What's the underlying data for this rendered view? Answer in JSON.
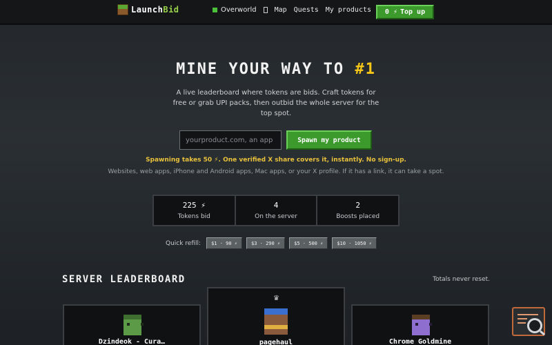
{
  "header": {
    "logo_text_main": "Launch",
    "logo_text_accent": "Bid",
    "world_label": "Overworld",
    "nav": [
      "Map",
      "Quests",
      "My products"
    ],
    "topup_amount": "0 ⚡",
    "topup_label": "Top up"
  },
  "hero": {
    "title_main": "MINE YOUR WAY TO",
    "title_accent": "#1",
    "subtitle": "A live leaderboard where tokens are bids. Craft tokens for free or grab UPI packs, then outbid the whole server for the top spot.",
    "input_placeholder": "yourproduct.com, an app li",
    "spawn_button": "Spawn my product",
    "note_cost": "Spawning takes 50 ⚡. One verified X share covers it, instantly. No sign-up.",
    "note_types": "Websites, web apps, iPhone and Android apps, Mac apps, or your X profile. If it has a link, it can take a spot."
  },
  "stats": [
    {
      "value": "225 ⚡",
      "label": "Tokens bid"
    },
    {
      "value": "4",
      "label": "On the server"
    },
    {
      "value": "2",
      "label": "Boosts placed"
    }
  ],
  "refill": {
    "label": "Quick refill:",
    "options": [
      "$1 · 90 ⚡",
      "$3 · 290 ⚡",
      "$5 · 500 ⚡",
      "$10 · 1050 ⚡"
    ]
  },
  "leaderboard": {
    "title": "SERVER LEADERBOARD",
    "note": "Totals never reset.",
    "crown": "♛",
    "entries": [
      {
        "name": "Dzindeok - Cura…",
        "avatar_icon": "zombie-avatar"
      },
      {
        "name": "pagehaul",
        "avatar_icon": "king-avatar"
      },
      {
        "name": "Chrome Goldmine",
        "avatar_icon": "purple-avatar"
      }
    ]
  },
  "colors": {
    "accent_green": "#3c9a2d",
    "accent_yellow": "#f5c518",
    "note_yellow": "#e9c23c"
  }
}
